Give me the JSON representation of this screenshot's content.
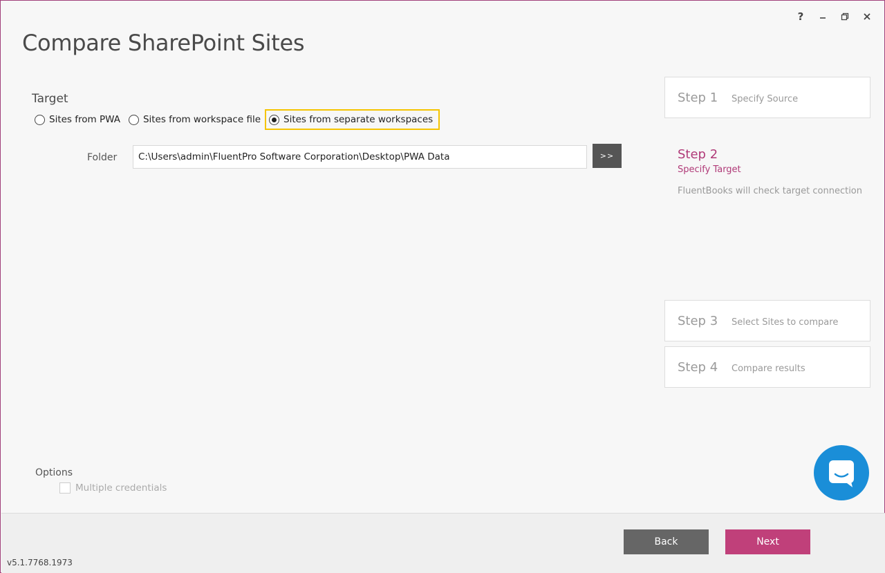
{
  "window": {
    "title": "Compare SharePoint Sites",
    "controls": {
      "help": "?",
      "minimize": "minimize-icon",
      "restore": "restore-icon",
      "close": "close-icon"
    }
  },
  "target": {
    "label": "Target",
    "options": [
      {
        "label": "Sites from PWA",
        "selected": false
      },
      {
        "label": "Sites from workspace file",
        "selected": false
      },
      {
        "label": "Sites from separate workspaces",
        "selected": true
      }
    ],
    "folder_label": "Folder",
    "folder_value": "C:\\Users\\admin\\FluentPro Software Corporation\\Desktop\\PWA Data",
    "browse_label": ">>"
  },
  "steps": [
    {
      "num": "Step 1",
      "desc": "Specify Source"
    },
    {
      "num": "Step 2",
      "desc": "Specify Target",
      "note": "FluentBooks will check target connection"
    },
    {
      "num": "Step 3",
      "desc": "Select Sites to compare"
    },
    {
      "num": "Step 4",
      "desc": "Compare results"
    }
  ],
  "options": {
    "label": "Options",
    "multiple_credentials": {
      "label": "Multiple credentials",
      "checked": false
    }
  },
  "footer": {
    "back": "Back",
    "next": "Next",
    "version": "v5.1.7768.1973"
  },
  "colors": {
    "accent": "#c0407a",
    "highlight": "#f5c400",
    "chat": "#1a8ed8"
  }
}
